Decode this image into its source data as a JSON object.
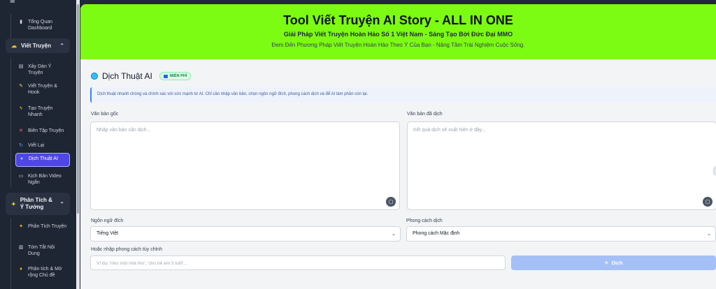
{
  "sidebar": {
    "items_top": [
      {
        "label": "Tổng Quan Dashboard",
        "icon": "chart-icon"
      }
    ],
    "group1": {
      "label": "Viết Truyện",
      "icon": "cloud-icon"
    },
    "group1_items": [
      {
        "label": "Xây Dàn Ý Truyện",
        "icon": "document-icon"
      },
      {
        "label": "Viết Truyện & Hook",
        "icon": "pencil-icon"
      },
      {
        "label": "Tạo Truyện Nhanh",
        "icon": "lightning-icon"
      },
      {
        "label": "Biên Tập Truyện",
        "icon": "scissors-icon"
      },
      {
        "label": "Viết Lại",
        "icon": "refresh-icon"
      },
      {
        "label": "Dịch Thuật AI",
        "icon": "globe-icon"
      },
      {
        "label": "Kịch Bản Video Ngắn",
        "icon": "film-icon"
      }
    ],
    "group2": {
      "label": "Phân Tích & Ý Tưởng",
      "icon": "sparkle-icon"
    },
    "group2_items": [
      {
        "label": "Phân Tích Truyện",
        "icon": "sparkle-icon"
      },
      {
        "label": "Tóm Tắt Nội Dung",
        "icon": "clipboard-icon"
      },
      {
        "label": "Phân tích & Mở rộng Chủ đề",
        "icon": "bulb-icon"
      }
    ]
  },
  "banner": {
    "title": "Tool Viết Truyện AI Story - ALL IN ONE",
    "subtitle": "Giải Pháp Viết Truyện Hoàn Hảo Số 1 Việt Nam - Sáng Tạo Bởi Đức Đại MMO",
    "description": "Đem Đến Phương Pháp Viết Truyện Hoàn Hảo Theo Ý Của Bạn - Nâng Tầm Trải Nghiệm Cuộc Sống."
  },
  "section": {
    "title": "Dịch Thuật AI",
    "badge": "MIỄN PHÍ",
    "info": "Dịch thuật nhanh chóng và chính xác với sức mạnh từ AI. Chỉ cần nhập văn bản, chọn ngôn ngữ đích, phong cách dịch và để AI làm phần còn lại."
  },
  "source": {
    "label": "Văn bản gốc",
    "placeholder": "Nhập văn bản cần dịch..."
  },
  "target": {
    "label": "Văn bản đã dịch",
    "placeholder": "Kết quả dịch sẽ xuất hiện ở đây..."
  },
  "language": {
    "label": "Ngôn ngữ đích",
    "value": "Tiếng Việt"
  },
  "style": {
    "label": "Phong cách dịch",
    "value": "Phong cách Mặc định"
  },
  "custom_style": {
    "label": "Hoặc nhập phong cách tùy chỉnh",
    "placeholder": "Ví dụ: 'như một nhà thơ', 'cho trẻ em 5 tuổi'..."
  },
  "translate_button": {
    "label": "Dịch"
  }
}
